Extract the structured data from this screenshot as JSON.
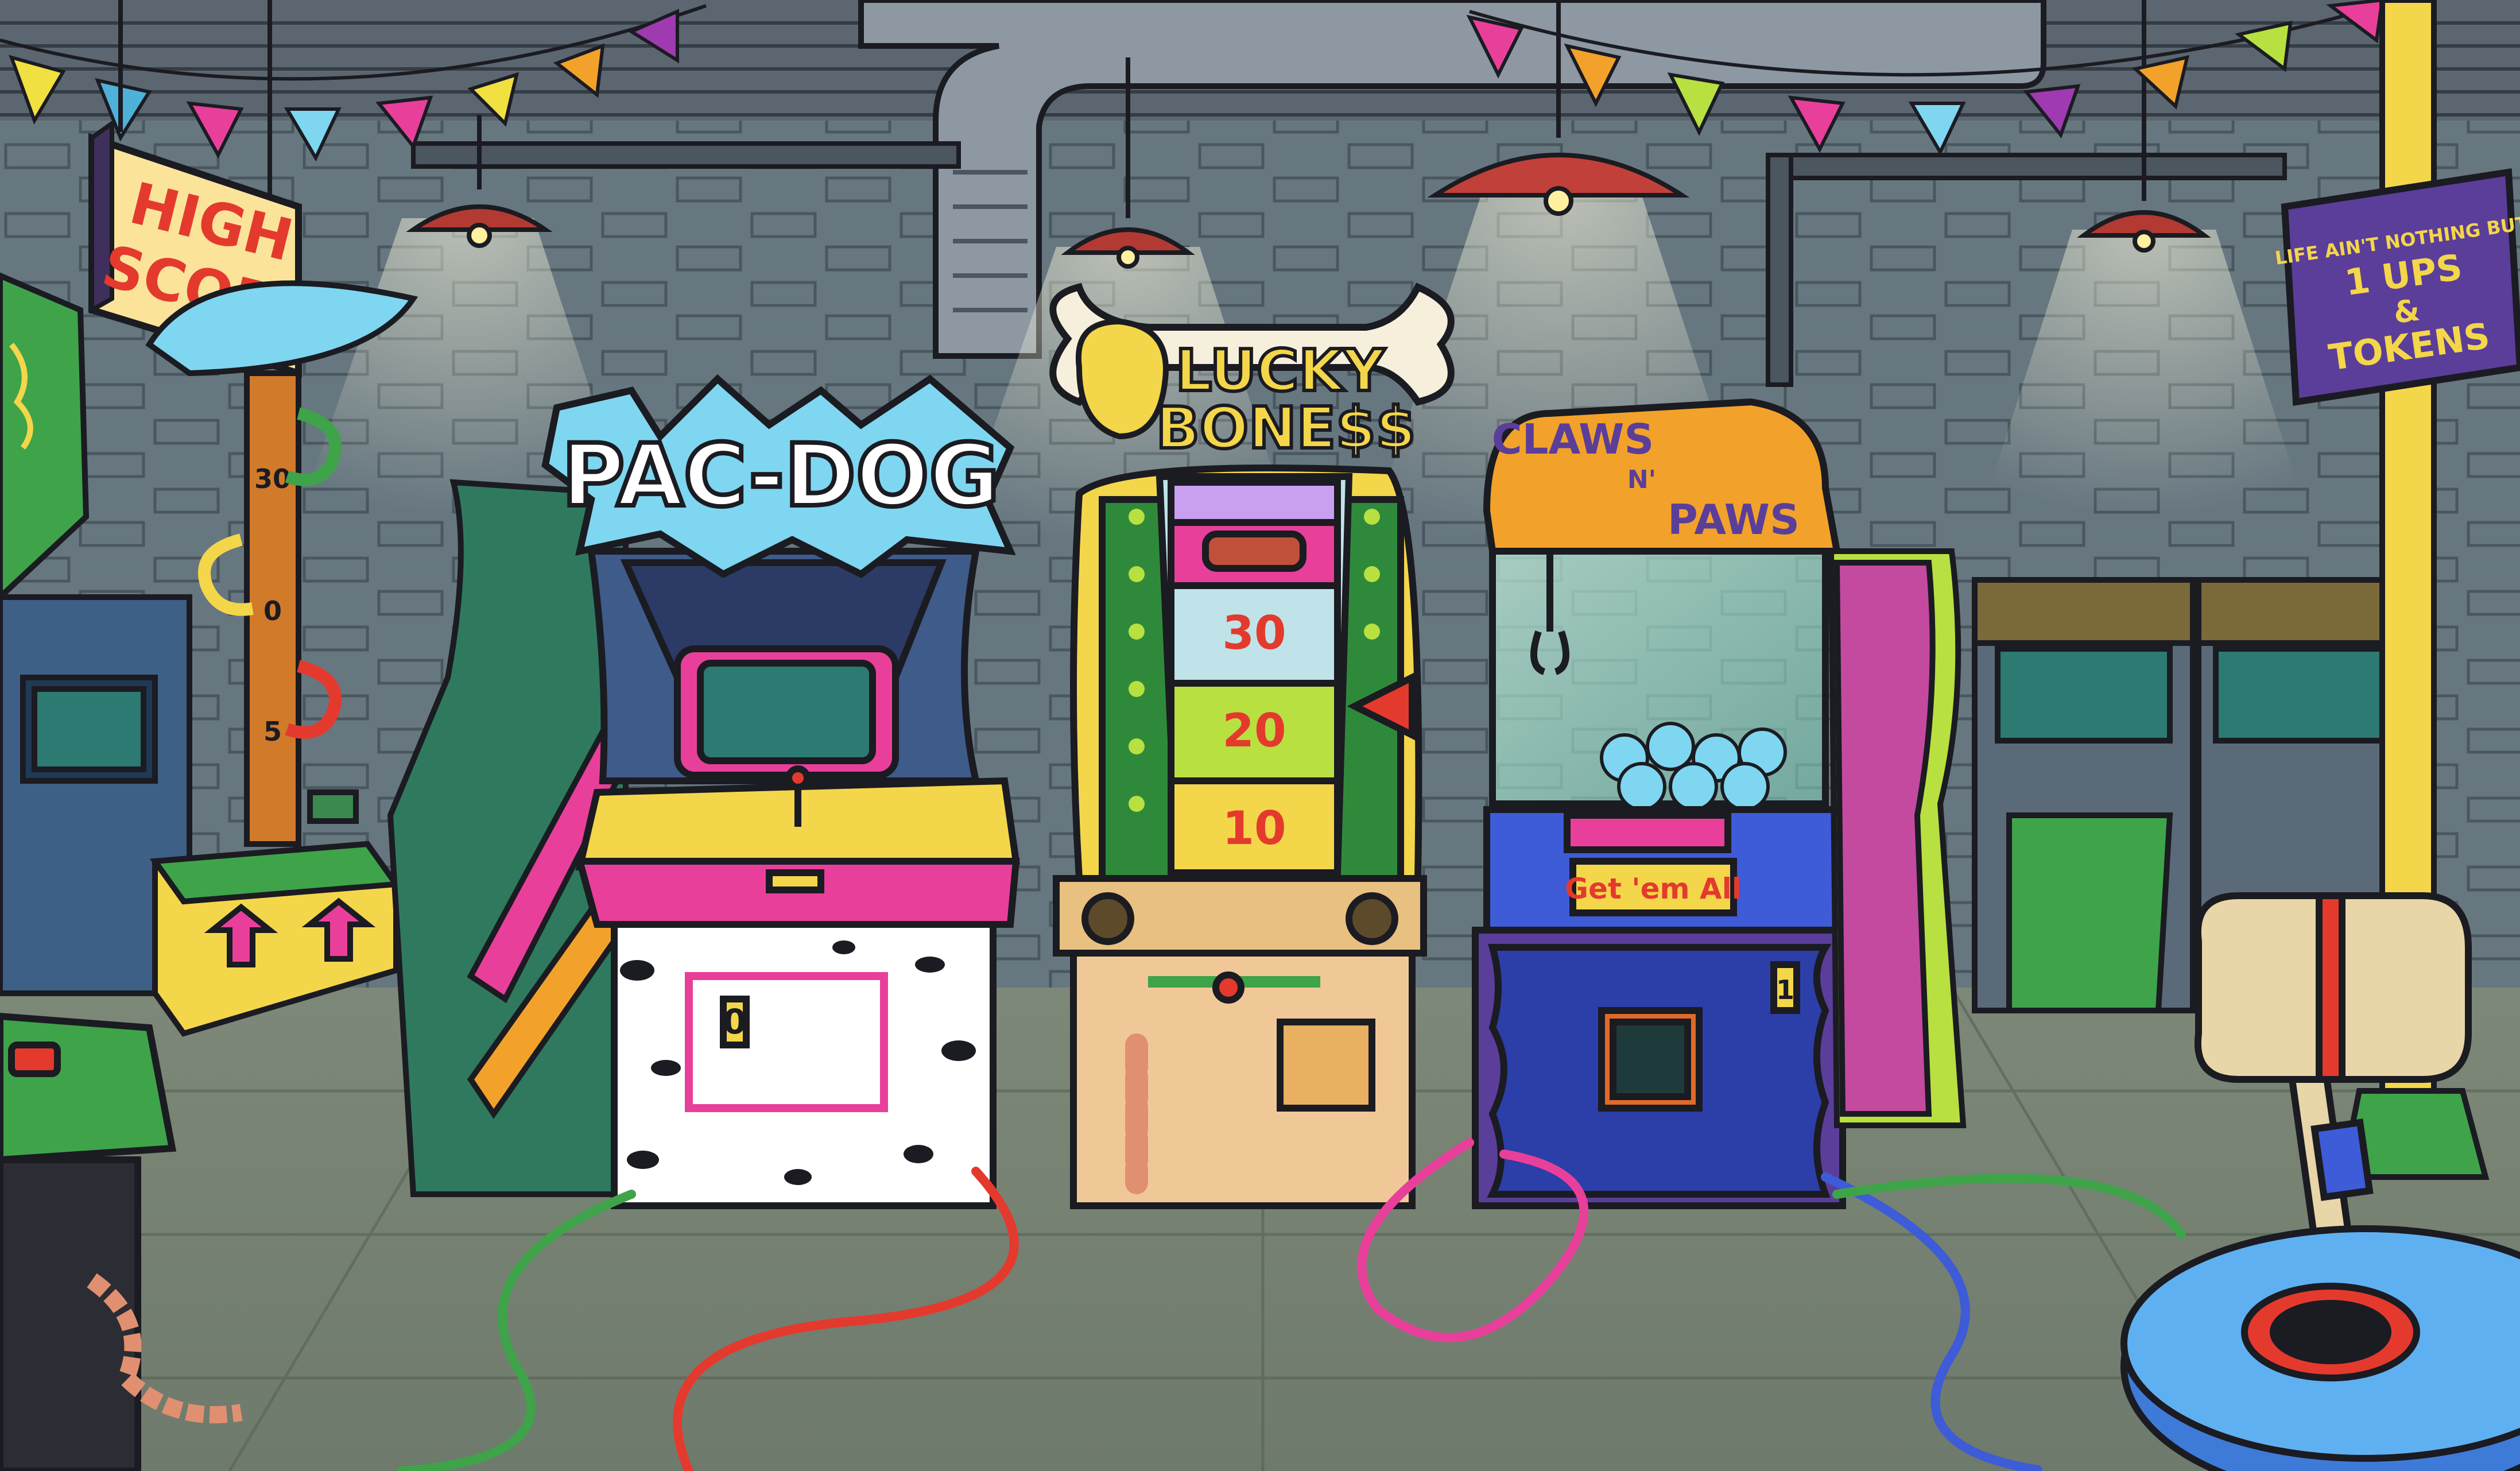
{
  "scene": {
    "high_score_sign": {
      "line1": "HIGH",
      "line2": "SCORE"
    },
    "strength_tester": {
      "marks": [
        "30",
        "0",
        "5"
      ]
    },
    "pac_dog": {
      "title": "PAC-DOG",
      "coin_label": "0"
    },
    "lucky_bones": {
      "line1": "LUCKY",
      "line2": "BONE$$",
      "wheel_values": [
        "30",
        "20",
        "10"
      ]
    },
    "claws_n_paws": {
      "word1": "CLAWS",
      "word2": "N'",
      "word3": "PAWS",
      "panel_label": "Get 'em All",
      "coin_label": "1"
    },
    "wall_sign": {
      "line1": "LIFE AIN'T NOTHING BUT",
      "line2": "1 UPS",
      "line3": "&",
      "line4": "TOKENS"
    }
  },
  "colors": {
    "wall": "#6f7e86",
    "floor": "#8a9385",
    "outline": "#1b1b22",
    "pink": "#e8409a",
    "cyan": "#7fd6f0",
    "yellow": "#f4d64a",
    "green": "#3fa34a",
    "purple": "#5a3e9a",
    "orange": "#f2a22a",
    "red": "#e43a2e"
  }
}
